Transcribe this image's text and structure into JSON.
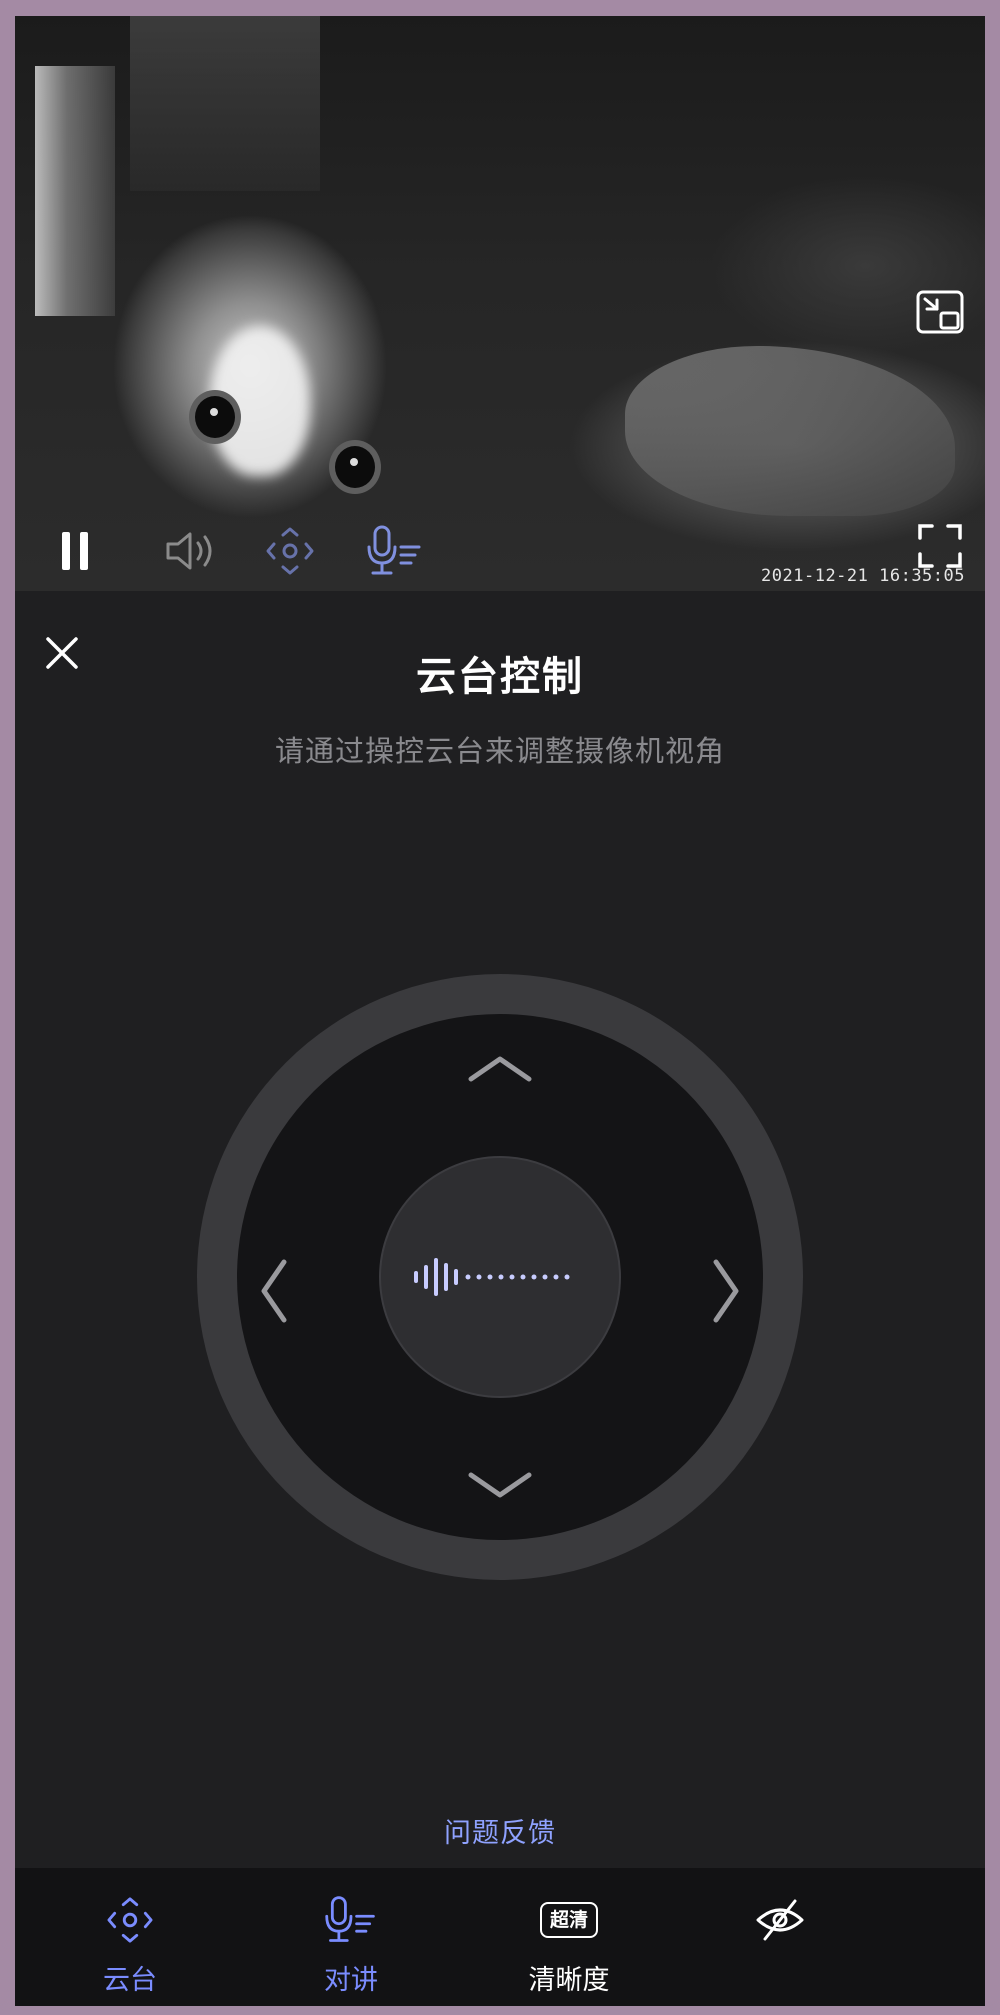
{
  "video": {
    "timestamp": "2021-12-21 16:35:05"
  },
  "panel": {
    "title": "云台控制",
    "subtitle": "请通过操控云台来调整摄像机视角",
    "feedback_link": "问题反馈"
  },
  "bottom_bar": {
    "tabs": [
      {
        "label": "云台",
        "icon": "ptz-icon",
        "color": "#7a8cff"
      },
      {
        "label": "对讲",
        "icon": "microphone-icon",
        "color": "#7a8cff"
      },
      {
        "label": "清晰度",
        "icon": "hd-badge-icon",
        "badge": "超清",
        "color": "#ffffff"
      },
      {
        "label": "",
        "icon": "eye-off-icon",
        "color": "#ffffff"
      }
    ]
  },
  "colors": {
    "background": "#1f1f21",
    "accent": "#7a8cff",
    "ring": "#3a3a3d",
    "pad": "#141416"
  }
}
